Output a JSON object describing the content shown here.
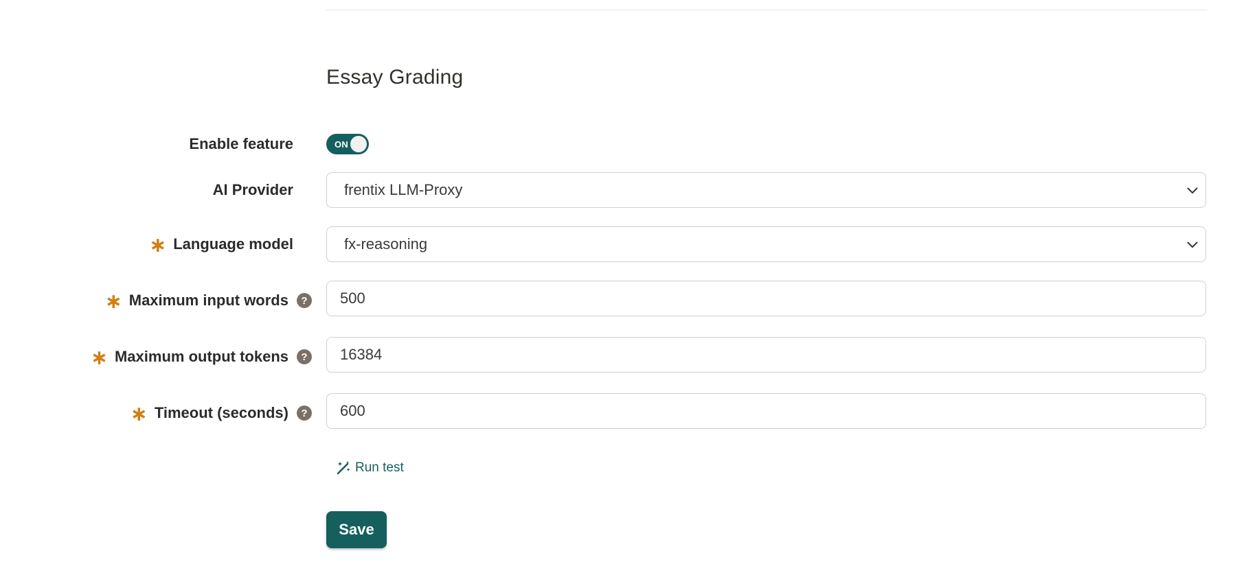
{
  "section": {
    "title": "Essay Grading"
  },
  "enable_feature": {
    "label": "Enable feature",
    "toggle_text": "ON"
  },
  "ai_provider": {
    "label": "AI Provider",
    "value": "frentix LLM-Proxy"
  },
  "language_model": {
    "label": "Language model",
    "required": "∗",
    "value": "fx-reasoning"
  },
  "max_input_words": {
    "label": "Maximum input words",
    "required": "∗",
    "help": "?",
    "value": "500"
  },
  "max_output_tokens": {
    "label": "Maximum output tokens",
    "required": "∗",
    "help": "?",
    "value": "16384"
  },
  "timeout": {
    "label": "Timeout (seconds)",
    "required": "∗",
    "help": "?",
    "value": "600"
  },
  "actions": {
    "run_test": "Run test",
    "save": "Save"
  },
  "colors": {
    "primary": "#155f5f",
    "required": "#d17f14",
    "help_icon_bg": "#7a7068"
  },
  "icons": {
    "run_test": "magic-wand-icon",
    "select": "chevron-down-icon",
    "help": "help-icon"
  }
}
